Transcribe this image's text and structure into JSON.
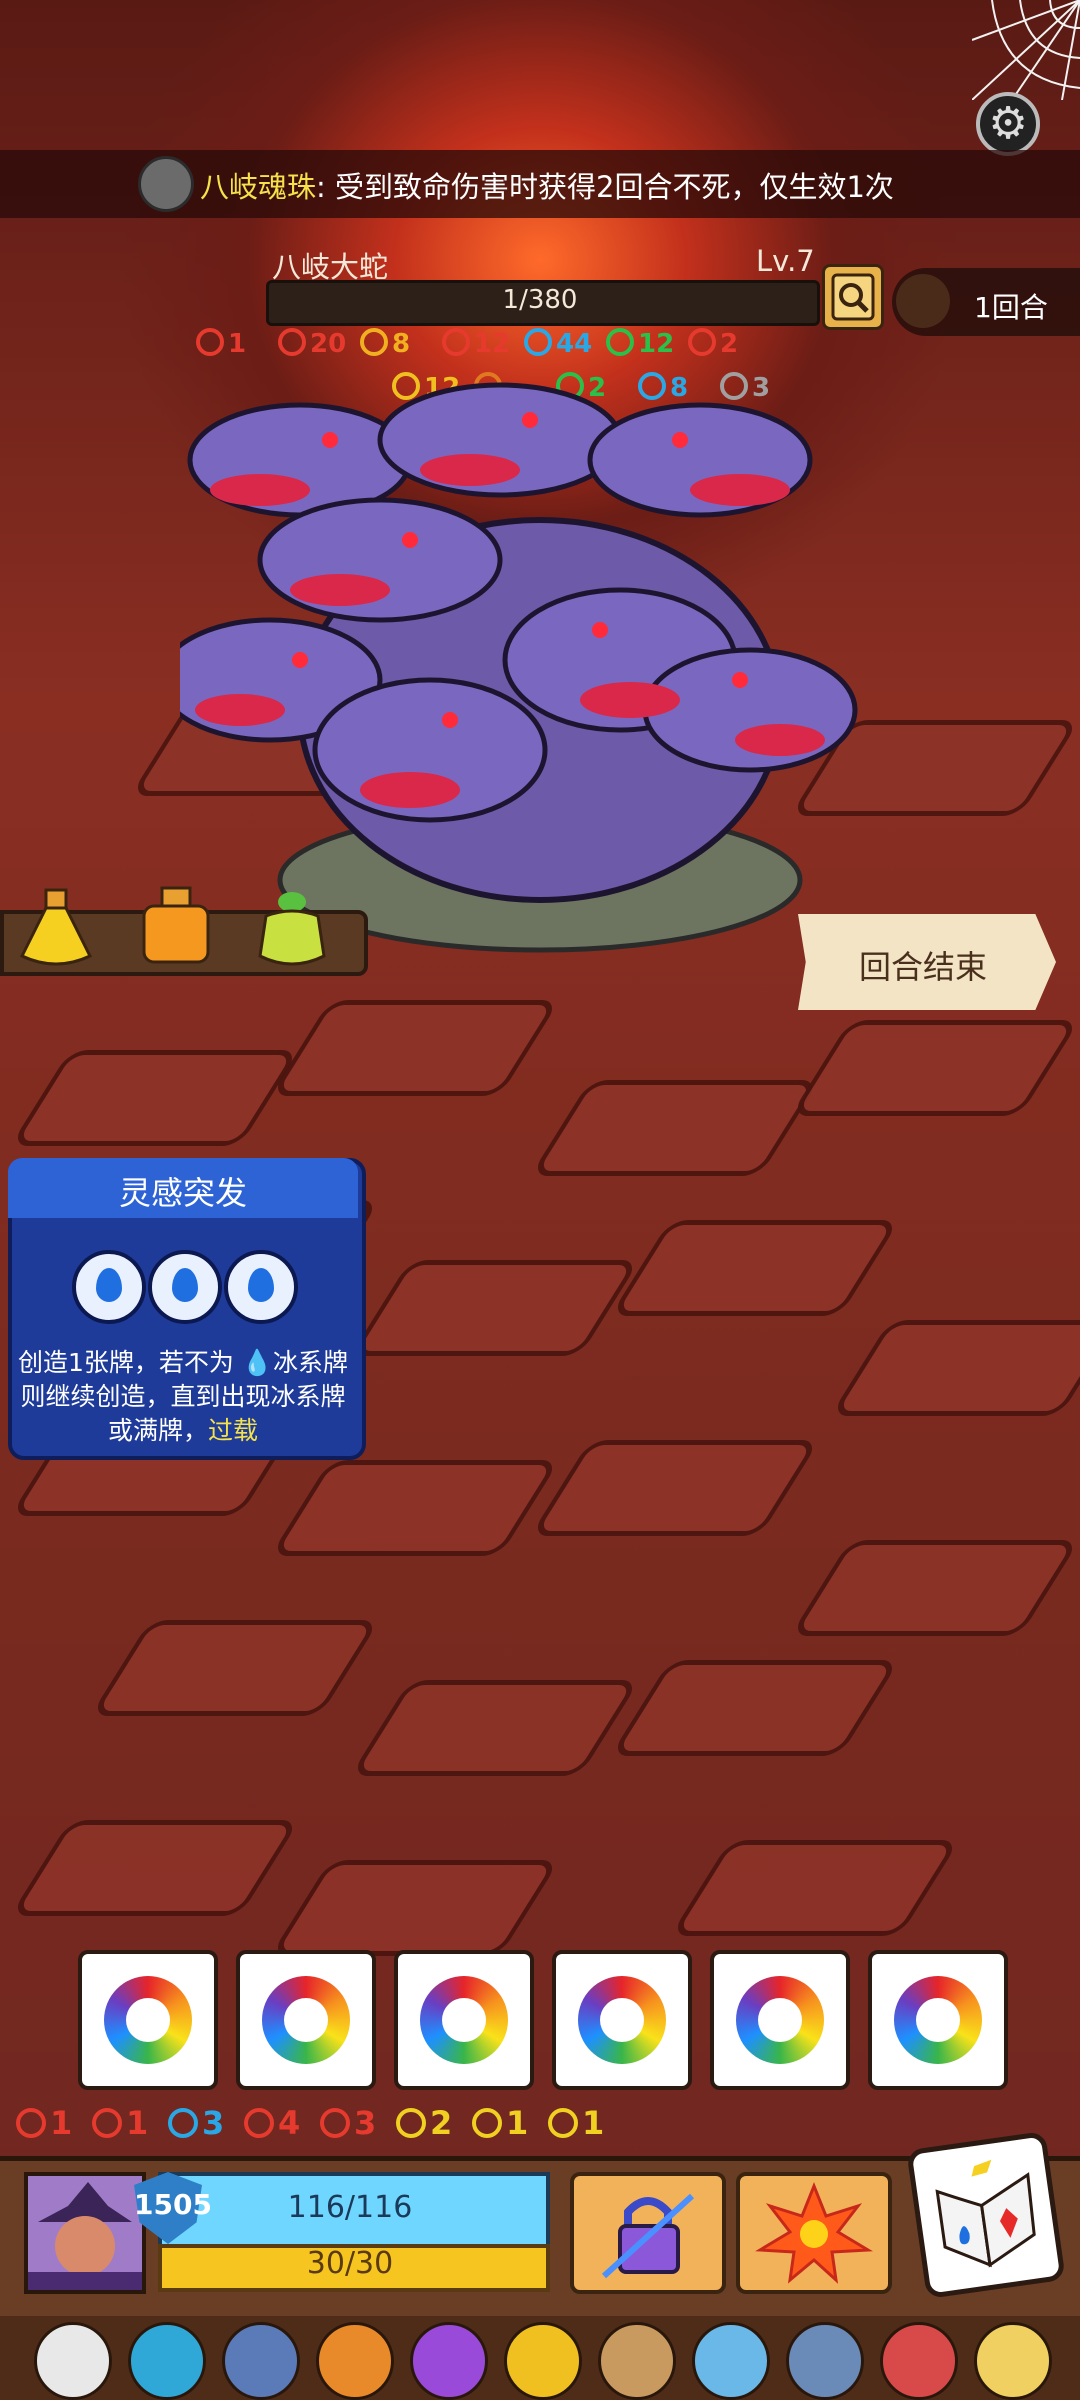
{
  "relic_banner": {
    "name": "八岐魂珠",
    "text": ": 受到致命伤害时获得2回合不死，仅生效1次"
  },
  "enemy": {
    "name": "八岐大蛇",
    "level": "Lv.7",
    "hp": "1/380",
    "statuses_row1": [
      {
        "value": "1",
        "color": "#e63a2e",
        "icon": "spiral-icon"
      },
      {
        "value": "20",
        "color": "#e63a2e",
        "icon": "flame-icon"
      },
      {
        "value": "8",
        "color": "#f0b020",
        "icon": "lock-icon"
      },
      {
        "value": "12",
        "color": "#e63a2e",
        "icon": "fire-icon"
      },
      {
        "value": "44",
        "color": "#2aa8e6",
        "icon": "snowflake-icon"
      },
      {
        "value": "12",
        "color": "#2ac04a",
        "icon": "poison-icon"
      },
      {
        "value": "2",
        "color": "#e63a2e",
        "icon": "claw-icon"
      }
    ],
    "statuses_row2": [
      {
        "value": "12",
        "color": "#f0c020",
        "icon": "triangle-icon"
      },
      {
        "value": "",
        "color": "#e07a20",
        "icon": "feather-icon"
      },
      {
        "value": "2",
        "color": "#2ac04a",
        "icon": "clover-icon"
      },
      {
        "value": "8",
        "color": "#2aa8e6",
        "icon": "bubble-icon"
      },
      {
        "value": "3",
        "color": "#a0a0a0",
        "icon": "eye-icon"
      }
    ]
  },
  "round": {
    "label": "1回合"
  },
  "end_turn": {
    "label": "回合结束"
  },
  "card": {
    "title": "灵感突发",
    "desc_part1": "创造1张牌，若不为",
    "desc_part2": "冰系牌则继续创造，直到出现冰系牌或满牌，",
    "desc_highlight": "过载",
    "cost_icons": [
      "water-drop-icon",
      "water-drop-icon",
      "water-drop-icon"
    ]
  },
  "dice_count": 6,
  "dice_stats": [
    {
      "value": "1",
      "color": "#e63a2e",
      "icon": "spiral-icon"
    },
    {
      "value": "1",
      "color": "#e63a2e",
      "icon": "sword-icon"
    },
    {
      "value": "3",
      "color": "#2aa8e6",
      "icon": "swirl-icon"
    },
    {
      "value": "4",
      "color": "#e63a2e",
      "icon": "shield-icon"
    },
    {
      "value": "3",
      "color": "#e63a2e",
      "icon": "broken-shield-icon"
    },
    {
      "value": "2",
      "color": "#f0d020",
      "icon": "star-icon"
    },
    {
      "value": "1",
      "color": "#f0d020",
      "icon": "armor-icon"
    },
    {
      "value": "1",
      "color": "#f0d020",
      "icon": "lightning-icon"
    }
  ],
  "player": {
    "shield": "1505",
    "hp": "116/116",
    "mana": "30/30"
  },
  "relics": [
    "horned-skull-icon",
    "blue-gem-icon",
    "fish-icon",
    "orange-garment-icon",
    "purple-potion-icon",
    "golden-urn-icon",
    "horn-icon",
    "ice-sword-icon",
    "crystal-icon",
    "spiked-bracelet-icon",
    "claw-icon"
  ]
}
